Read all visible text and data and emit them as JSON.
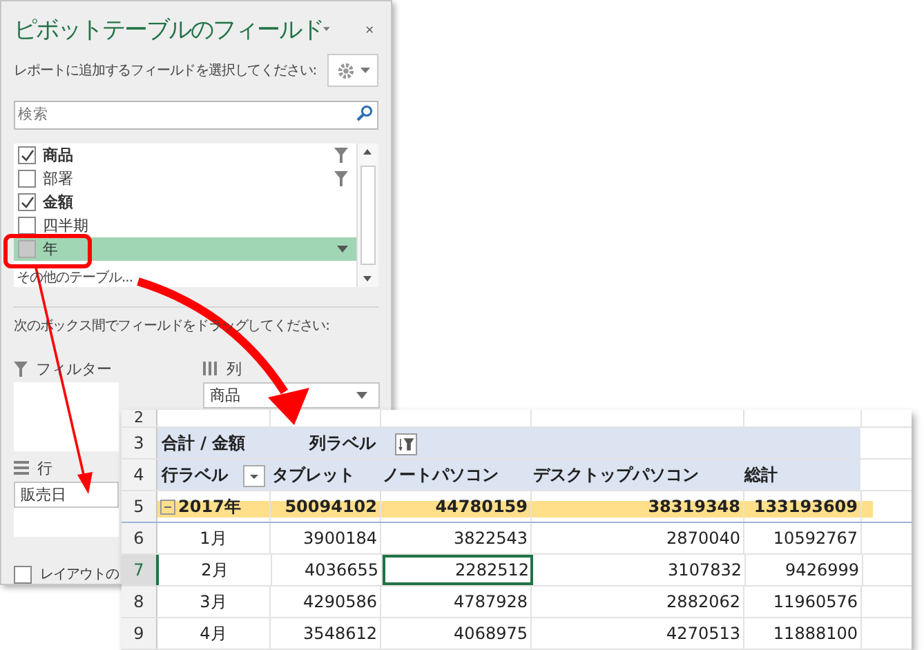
{
  "panel": {
    "title": "ピボットテーブルのフィールド",
    "subtitle": "レポートに追加するフィールドを選択してください:",
    "search": {
      "placeholder": "検索"
    },
    "fields": [
      {
        "label": "商品",
        "checked": true,
        "filtered": true,
        "selected": false
      },
      {
        "label": "部署",
        "checked": false,
        "filtered": true,
        "selected": false
      },
      {
        "label": "金額",
        "checked": true,
        "filtered": false,
        "selected": false
      },
      {
        "label": "四半期",
        "checked": false,
        "filtered": false,
        "selected": false
      },
      {
        "label": "年",
        "checked": false,
        "filtered": false,
        "selected": true
      }
    ],
    "more_tables": "その他のテーブル...",
    "drag_hint": "次のボックス間でフィールドをドラッグしてください:",
    "areas": [
      {
        "kind": "filter",
        "label": "フィルター"
      },
      {
        "kind": "columns",
        "label": "列",
        "items": [
          "商品"
        ]
      },
      {
        "kind": "rows",
        "label": "行",
        "items": [
          "販売日"
        ]
      }
    ],
    "defer_layout": {
      "label": "レイアウトの",
      "checked": false
    }
  },
  "sheet": {
    "blank_row": "2",
    "header_rows": [
      {
        "num": "3",
        "cells": [
          "合計 / 金額",
          "列ラベル"
        ]
      },
      {
        "num": "4",
        "cells": [
          "行ラベル",
          "タブレット",
          "ノートパソコン",
          "デスクトップパソコン",
          "総計"
        ]
      }
    ],
    "total_row": {
      "num": "5",
      "cells": [
        "2017年",
        "50094102",
        "44780159",
        "38319348",
        "133193609"
      ]
    },
    "rows": [
      {
        "num": "6",
        "cells": [
          {
            "text": "1月",
            "selected": false
          },
          {
            "text": "3900184",
            "selected": false
          },
          {
            "text": "3822543",
            "selected": false
          },
          {
            "text": "2870040",
            "selected": false
          },
          {
            "text": "10592767",
            "selected": false
          }
        ]
      },
      {
        "num": "7",
        "cells": [
          {
            "text": "2月",
            "selected": false
          },
          {
            "text": "4036655",
            "selected": false
          },
          {
            "text": "2282512",
            "selected": true
          },
          {
            "text": "3107832",
            "selected": false
          },
          {
            "text": "9426999",
            "selected": false
          }
        ]
      },
      {
        "num": "8",
        "cells": [
          {
            "text": "3月",
            "selected": false
          },
          {
            "text": "4290586",
            "selected": false
          },
          {
            "text": "4787928",
            "selected": false
          },
          {
            "text": "2882062",
            "selected": false
          },
          {
            "text": "11960576",
            "selected": false
          }
        ]
      },
      {
        "num": "9",
        "cells": [
          {
            "text": "4月",
            "selected": false
          },
          {
            "text": "3548612",
            "selected": false
          },
          {
            "text": "4068975",
            "selected": false
          },
          {
            "text": "4270513",
            "selected": false
          },
          {
            "text": "11888100",
            "selected": false
          }
        ]
      }
    ]
  }
}
